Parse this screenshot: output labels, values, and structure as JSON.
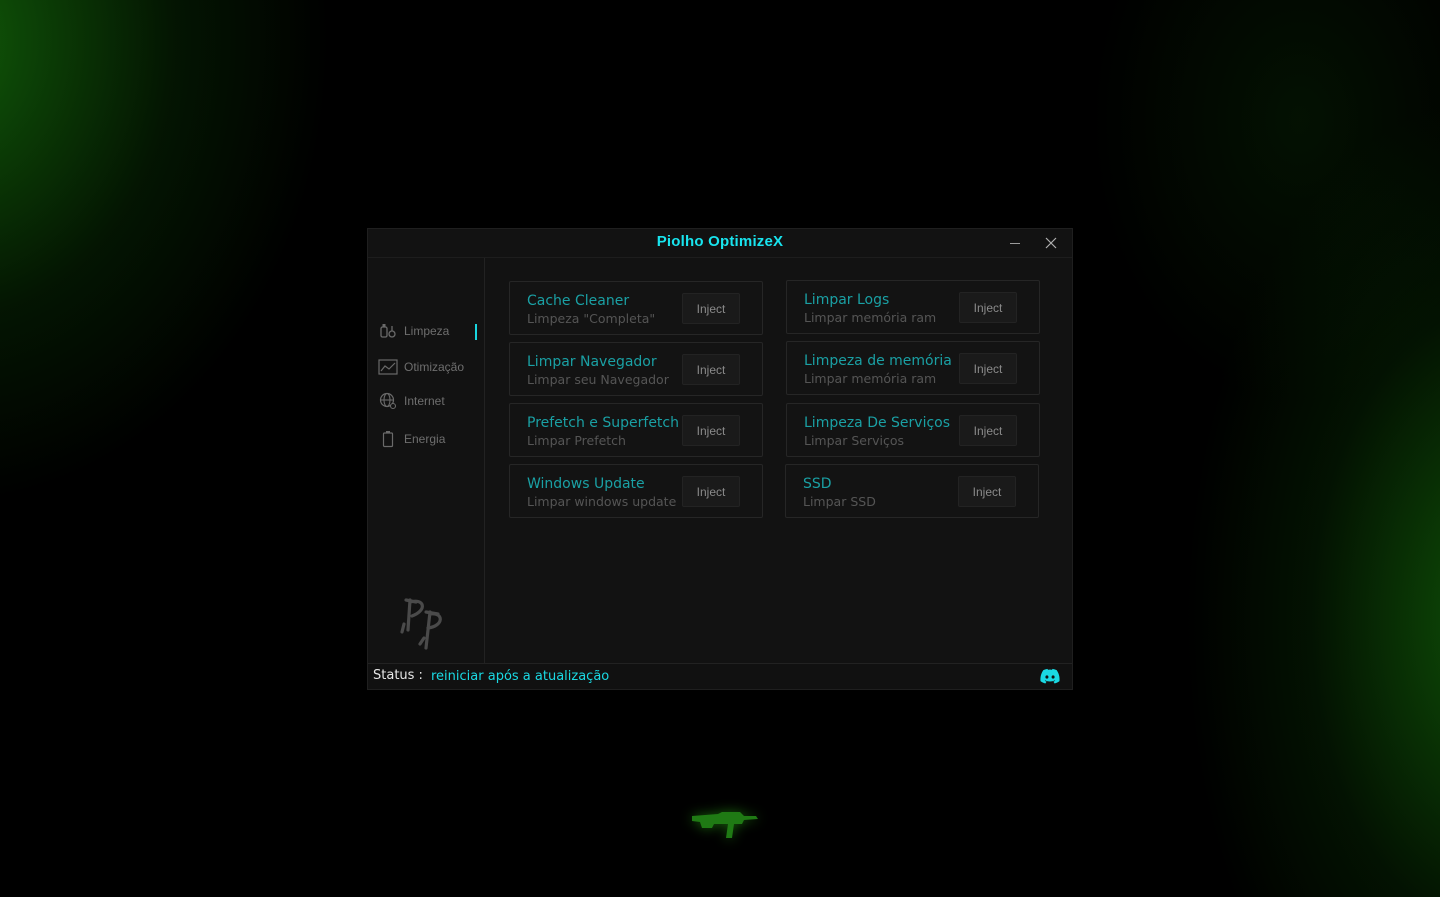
{
  "window": {
    "title": "Piolho OptimizeX"
  },
  "sidebar": {
    "items": [
      {
        "label": "Limpeza",
        "icon": "cleaning-icon",
        "active": true
      },
      {
        "label": "Otimização",
        "icon": "chart-icon",
        "active": false
      },
      {
        "label": "Internet",
        "icon": "globe-icon",
        "active": false
      },
      {
        "label": "Energia",
        "icon": "battery-icon",
        "active": false
      }
    ],
    "logo_icon": "pp-logo-icon"
  },
  "cards": [
    {
      "title": "Cache Cleaner",
      "subtitle": "Limpeza \"Completa\"",
      "button": "Inject"
    },
    {
      "title": "Limpar Logs",
      "subtitle": "Limpar memória ram",
      "button": "Inject"
    },
    {
      "title": "Limpar Navegador",
      "subtitle": "Limpar seu Navegador",
      "button": "Inject"
    },
    {
      "title": "Limpeza de memória",
      "subtitle": "Limpar memória ram",
      "button": "Inject"
    },
    {
      "title": "Prefetch e Superfetch",
      "subtitle": "Limpar Prefetch",
      "button": "Inject"
    },
    {
      "title": "Limpeza De Serviços",
      "subtitle": "Limpar Serviços",
      "button": "Inject"
    },
    {
      "title": "Windows Update",
      "subtitle": "Limpar windows update",
      "button": "Inject"
    },
    {
      "title": "SSD",
      "subtitle": "Limpar SSD",
      "button": "Inject"
    }
  ],
  "status": {
    "label": "Status :",
    "value": "reiniciar após a atualização"
  },
  "colors": {
    "accent": "#19d5df",
    "card_title": "#1aa0a4",
    "background": "#121212"
  }
}
